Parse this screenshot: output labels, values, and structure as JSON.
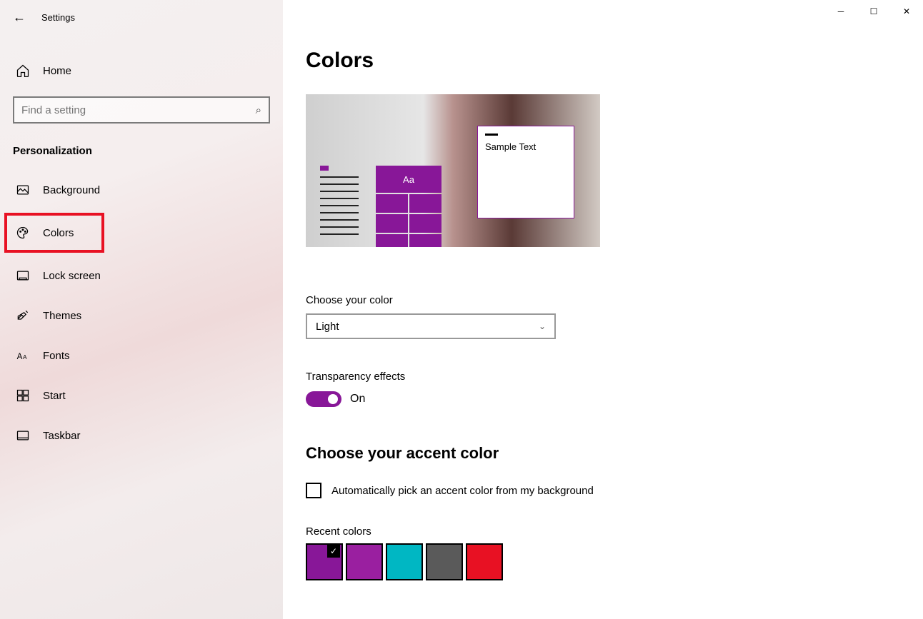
{
  "titlebar": {
    "app_name": "Settings"
  },
  "sidebar": {
    "home_label": "Home",
    "search_placeholder": "Find a setting",
    "section_label": "Personalization",
    "items": [
      {
        "label": "Background"
      },
      {
        "label": "Colors"
      },
      {
        "label": "Lock screen"
      },
      {
        "label": "Themes"
      },
      {
        "label": "Fonts"
      },
      {
        "label": "Start"
      },
      {
        "label": "Taskbar"
      }
    ]
  },
  "main": {
    "page_title": "Colors",
    "preview": {
      "sample_text": "Sample Text",
      "tile_text": "Aa"
    },
    "choose_color": {
      "label": "Choose your color",
      "value": "Light"
    },
    "transparency": {
      "label": "Transparency effects",
      "state": "On"
    },
    "accent": {
      "title": "Choose your accent color",
      "auto_pick": "Automatically pick an accent color from my background",
      "recent_label": "Recent colors",
      "recent_colors": [
        "#881798",
        "#9a1fa0",
        "#00b7c3",
        "#5a5a5a",
        "#e81123"
      ]
    }
  }
}
